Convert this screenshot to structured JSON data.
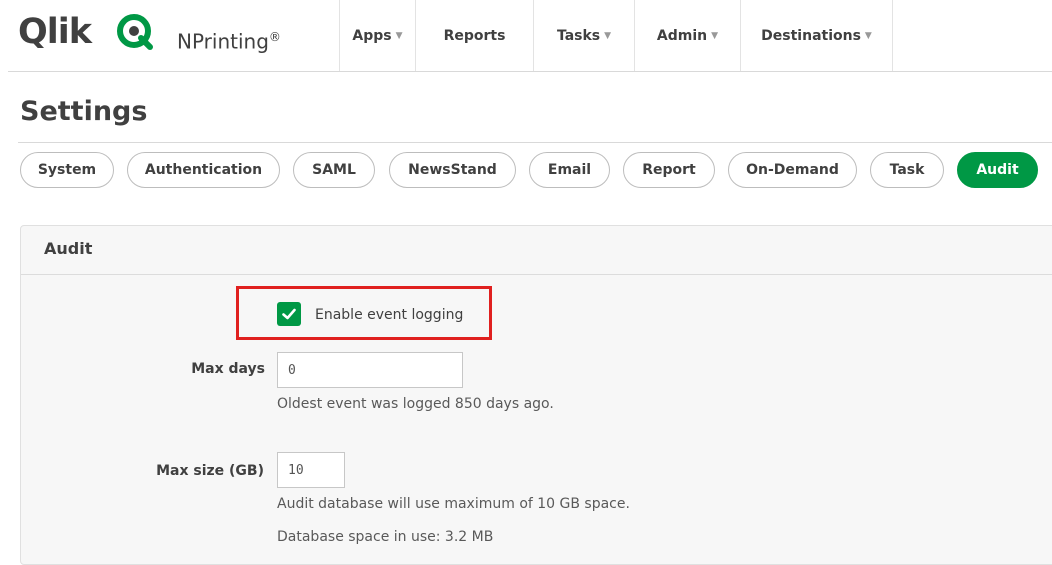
{
  "header": {
    "logo_text": "Qlik",
    "product": "NPrinting",
    "product_mark": "®",
    "nav": [
      {
        "label": "Apps",
        "dropdown": true
      },
      {
        "label": "Reports",
        "dropdown": false
      },
      {
        "label": "Tasks",
        "dropdown": true
      },
      {
        "label": "Admin",
        "dropdown": true
      },
      {
        "label": "Destinations",
        "dropdown": true
      }
    ]
  },
  "page": {
    "title": "Settings"
  },
  "tabs": [
    {
      "label": "System",
      "active": false
    },
    {
      "label": "Authentication",
      "active": false
    },
    {
      "label": "SAML",
      "active": false
    },
    {
      "label": "NewsStand",
      "active": false
    },
    {
      "label": "Email",
      "active": false
    },
    {
      "label": "Report",
      "active": false
    },
    {
      "label": "On-Demand",
      "active": false
    },
    {
      "label": "Task",
      "active": false
    },
    {
      "label": "Audit",
      "active": true
    }
  ],
  "audit": {
    "title": "Audit",
    "enable_logging": {
      "label": "Enable event logging",
      "checked": true
    },
    "max_days": {
      "label": "Max days",
      "value": "0",
      "help": "Oldest event was logged 850 days ago."
    },
    "max_size": {
      "label": "Max size (GB)",
      "value": "10",
      "help": "Audit database will use maximum of 10 GB space.",
      "usage": "Database space in use: 3.2 MB"
    }
  },
  "colors": {
    "accent": "#009845",
    "highlight": "#e0201f",
    "text": "#404040"
  },
  "icons": {
    "logo": "qlik-q-logo-icon",
    "dropdown": "chevron-down-icon",
    "checkbox": "check-icon"
  }
}
